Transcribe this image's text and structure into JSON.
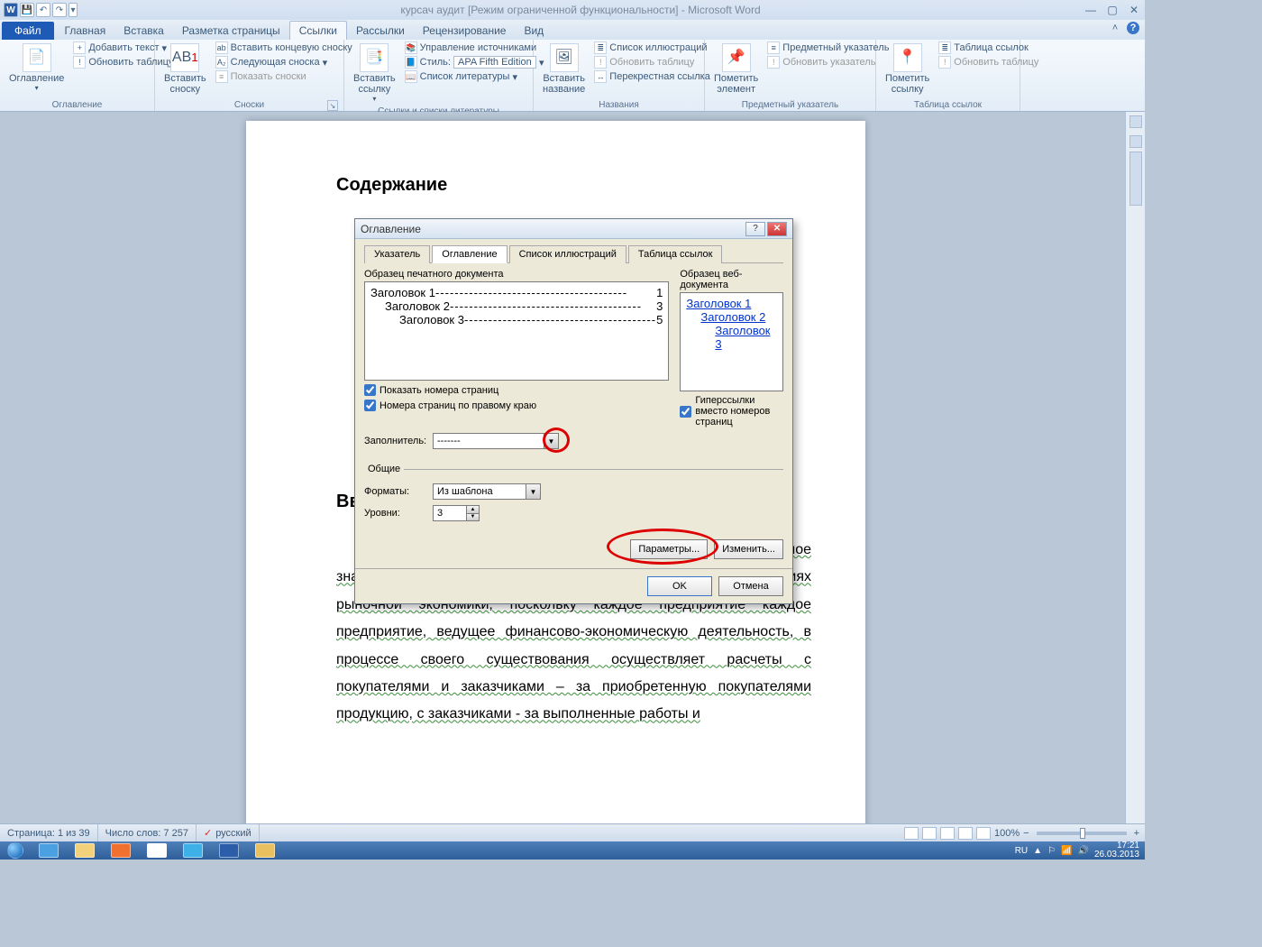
{
  "title": "курсач аудит [Режим ограниченной функциональности] - Microsoft Word",
  "tabs": {
    "file": "Файл",
    "items": [
      "Главная",
      "Вставка",
      "Разметка страницы",
      "Ссылки",
      "Рассылки",
      "Рецензирование",
      "Вид"
    ],
    "active": "Ссылки"
  },
  "ribbon": {
    "g1": {
      "label": "Оглавление",
      "big": "Оглавление",
      "add_text": "Добавить текст",
      "update": "Обновить таблицу"
    },
    "g2": {
      "label": "Сноски",
      "big": "Вставить сноску",
      "ab": "AB",
      "end": "Вставить концевую сноску",
      "next": "Следующая сноска",
      "show": "Показать сноски"
    },
    "g3": {
      "label": "Ссылки и списки литературы",
      "big": "Вставить ссылку",
      "manage": "Управление источниками",
      "style_lbl": "Стиль:",
      "style_val": "APA Fifth Edition",
      "biblio": "Список литературы"
    },
    "g4": {
      "label": "Названия",
      "big": "Вставить название",
      "list": "Список иллюстраций",
      "update": "Обновить таблицу",
      "cross": "Перекрестная ссылка"
    },
    "g5": {
      "label": "Предметный указатель",
      "big": "Пометить элемент",
      "index": "Предметный указатель",
      "update": "Обновить указатель"
    },
    "g6": {
      "label": "Таблица ссылок",
      "big": "Пометить ссылку",
      "table": "Таблица ссылок",
      "update": "Обновить таблицу"
    }
  },
  "document": {
    "h_toc": "Содержание",
    "h_intro": "Введение",
    "body": "Учет расчетов с покупателями и заказчиками имеет большое значение для любого предприятия, активно работающего в условиях рыночной экономики, поскольку каждое предприятие каждое предприятие, ведущее финансово-экономическую деятельность, в процессе своего существования осуществляет расчеты с покупателями и заказчиками – за приобретенную покупателями продукцию, с заказчиками - за выполненные работы и"
  },
  "dialog": {
    "title": "Оглавление",
    "tabs": [
      "Указатель",
      "Оглавление",
      "Список иллюстраций",
      "Таблица ссылок"
    ],
    "active_tab": "Оглавление",
    "print_preview_lbl": "Образец печатного документа",
    "web_preview_lbl": "Образец веб-документа",
    "print_items": [
      {
        "t": "Заголовок 1",
        "p": "1",
        "indent": 0
      },
      {
        "t": "Заголовок 2",
        "p": "3",
        "indent": 1
      },
      {
        "t": "Заголовок 3",
        "p": "5",
        "indent": 2
      }
    ],
    "web_items": [
      "Заголовок 1",
      "Заголовок 2",
      "Заголовок 3"
    ],
    "chk_show_pages": "Показать номера страниц",
    "chk_right_align": "Номера страниц по правому краю",
    "chk_hyperlinks": "Гиперссылки вместо номеров страниц",
    "leader_lbl": "Заполнитель:",
    "leader_val": "-------",
    "general_lbl": "Общие",
    "formats_lbl": "Форматы:",
    "formats_val": "Из шаблона",
    "levels_lbl": "Уровни:",
    "levels_val": "3",
    "btn_params": "Параметры...",
    "btn_modify": "Изменить...",
    "btn_ok": "OK",
    "btn_cancel": "Отмена"
  },
  "status": {
    "page": "Страница: 1 из 39",
    "words": "Число слов: 7 257",
    "lang": "русский",
    "zoom": "100%"
  },
  "tray": {
    "lang": "RU",
    "time": "17:21",
    "date": "26.03.2013"
  }
}
